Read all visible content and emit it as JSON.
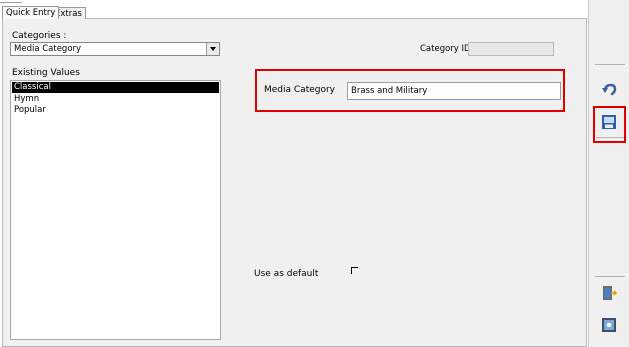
{
  "tabs": [
    {
      "label": "Quick Entry",
      "active": true
    },
    {
      "label": "Extras",
      "active": false
    }
  ],
  "categories": {
    "label": "Categories :",
    "selected": "Media Category"
  },
  "category_id": {
    "label": "Category ID:",
    "value": ""
  },
  "existing_values": {
    "label": "Existing Values",
    "items": [
      "Classical",
      "Hymn",
      "Popular"
    ],
    "selected_index": 0
  },
  "editor": {
    "field_label": "Media Category",
    "field_value": "Brass and Military"
  },
  "use_default": {
    "label": "Use as default",
    "checked": false
  },
  "toolbar": {
    "icons": [
      "undo-icon",
      "save-icon",
      "exit-icon",
      "screen-icon"
    ]
  },
  "colors": {
    "highlight": "#e00000",
    "panel": "#f0f0f0",
    "selection": "#000000"
  }
}
